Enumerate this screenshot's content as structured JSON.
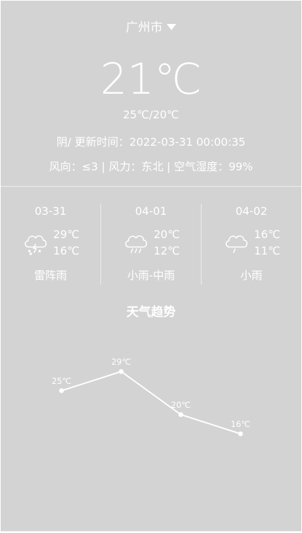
{
  "header": {
    "city": "广州市",
    "current_temp": "21℃",
    "temp_range": "25℃/20℃",
    "update_line": "阴/ 更新时间：2022-03-31 00:00:35",
    "wind_line": "风向：≤3 | 风力：东北 | 空气湿度：99%"
  },
  "forecast": [
    {
      "date": "03-31",
      "high": "29℃",
      "low": "16℃",
      "desc": "雷阵雨",
      "icon": "thunder-rain-icon"
    },
    {
      "date": "04-01",
      "high": "20℃",
      "low": "12℃",
      "desc": "小雨-中雨",
      "icon": "rain-icon"
    },
    {
      "date": "04-02",
      "high": "16℃",
      "low": "11℃",
      "desc": "小雨",
      "icon": "light-rain-icon"
    }
  ],
  "trend": {
    "title": "天气趋势"
  },
  "chart_data": {
    "type": "line",
    "series": [
      {
        "values": [
          25,
          29,
          20,
          16
        ],
        "labels": [
          "25℃",
          "29℃",
          "20℃",
          "16℃"
        ]
      }
    ],
    "ylim": [
      10,
      35
    ],
    "grid": false,
    "legend": "none",
    "color": "#ffffff"
  },
  "colors": {
    "background": "#d3d3d3",
    "text": "#ffffff",
    "divider": "#ededed"
  }
}
